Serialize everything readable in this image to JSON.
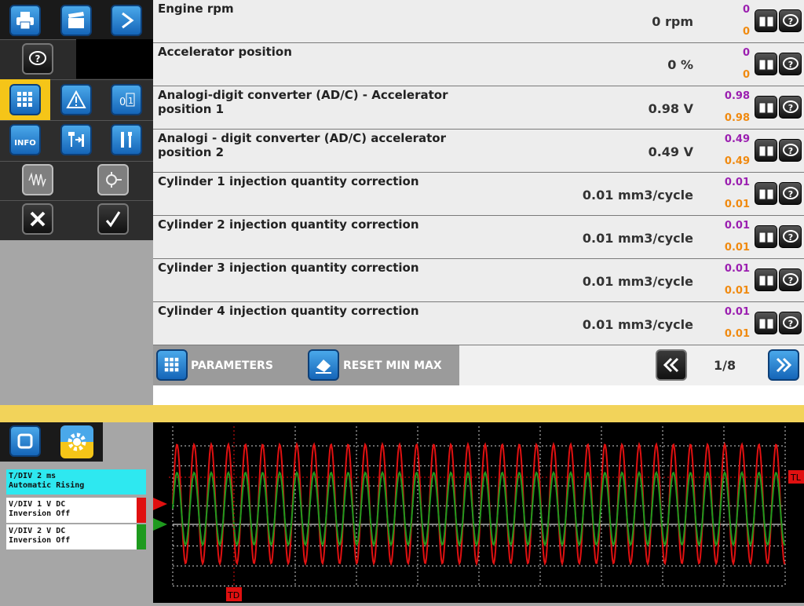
{
  "toolbar": {
    "print": "print-icon",
    "clapper": "clapperboard-icon",
    "play": "play-icon",
    "help": "help-icon",
    "grid": "grid-icon",
    "warning": "warning-icon",
    "zero_one": "zero-one-icon",
    "info_label": "INFO",
    "actuator": "actuator-icon",
    "tools": "tools-icon",
    "signal": "signal-icon",
    "sensor": "sensor-icon",
    "cancel": "close-icon",
    "confirm": "check-icon"
  },
  "parameters": [
    {
      "name": "Engine rpm",
      "value": "0 rpm",
      "max": "0",
      "min": "0"
    },
    {
      "name": "Accelerator position",
      "value": "0 %",
      "max": "0",
      "min": "0"
    },
    {
      "name": "Analogi-digit converter (AD/C)  - Accelerator position 1",
      "value": "0.98 V",
      "max": "0.98",
      "min": "0.98"
    },
    {
      "name": "Analogi - digit converter (AD/C) accelerator position 2",
      "value": "0.49 V",
      "max": "0.49",
      "min": "0.49"
    },
    {
      "name": "Cylinder 1 injection quantity correction",
      "value": "0.01 mm3/cycle",
      "max": "0.01",
      "min": "0.01"
    },
    {
      "name": "Cylinder 2 injection quantity correction",
      "value": "0.01 mm3/cycle",
      "max": "0.01",
      "min": "0.01"
    },
    {
      "name": "Cylinder 3 injection quantity correction",
      "value": "0.01 mm3/cycle",
      "max": "0.01",
      "min": "0.01"
    },
    {
      "name": "Cylinder 4 injection quantity correction",
      "value": "0.01 mm3/cycle",
      "max": "0.01",
      "min": "0.01"
    }
  ],
  "bottom_bar": {
    "parameters_label": "PARAMETERS",
    "reset_label": "RESET MIN MAX",
    "page": "1/8"
  },
  "oscilloscope": {
    "timebase_line1": "T/DIV  2 ms",
    "timebase_line2": "Automatic  Rising",
    "ch1_line1": "V/DIV  1 V  DC",
    "ch1_line2": "Inversion  Off",
    "ch2_line1": "V/DIV  2 V  DC",
    "ch2_line2": "Inversion  Off",
    "trigger_level_marker": "TL",
    "trigger_delay_marker": "TD",
    "colors": {
      "ch1": "#e01010",
      "ch2": "#1e9a1e",
      "timebase": "#2ee8f0",
      "grid": "#cfcfcf"
    }
  }
}
